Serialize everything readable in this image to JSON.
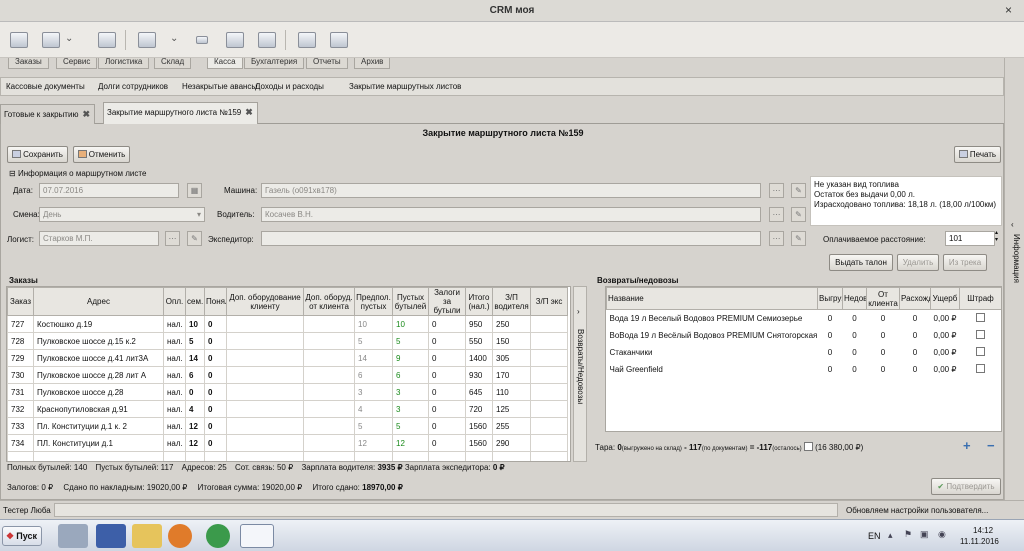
{
  "window": {
    "title": "CRM моя",
    "close": "×"
  },
  "module_tabs": [
    {
      "label": "Заказы"
    },
    {
      "label": "Сервис"
    },
    {
      "label": "Логистика"
    },
    {
      "label": "Склад"
    },
    {
      "label": "Касса"
    },
    {
      "label": "Бухгалтерия"
    },
    {
      "label": "Отчеты"
    },
    {
      "label": "Архив"
    }
  ],
  "subnav": [
    {
      "label": "Кассовые документы"
    },
    {
      "label": "Долги сотрудников"
    },
    {
      "label": "Незакрытые авансы"
    },
    {
      "label": "Доходы и расходы"
    },
    {
      "label": "Закрытие маршрутных листов"
    }
  ],
  "doc_tabs": [
    {
      "label": "Готовые к закрытию"
    },
    {
      "label": "Закрытие маршрутного листа №159"
    }
  ],
  "panel": {
    "title": "Закрытие маршрутного листа №159",
    "save_label": "Сохранить",
    "cancel_label": "Отменить",
    "print_label": "Печать",
    "info_section_label": "Информация о маршрутном листе",
    "date_label": "Дата:",
    "date_value": "07.07.2016",
    "shift_label": "Смена:",
    "shift_value": "День",
    "logist_label": "Логист:",
    "logist_value": "Старков М.П.",
    "car_label": "Машина:",
    "car_value": "Газель (о091хв178)",
    "driver_label": "Водитель:",
    "driver_value": "Косачев В.Н.",
    "forwarder_label": "Экспедитор:",
    "forwarder_value": "",
    "fuel_info": [
      "Не указан вид топлива",
      "Остаток без выдачи 0,00 л.",
      "Израсходовано топлива: 18,18 л. (18,00 л/100км)"
    ],
    "paid_distance_label": "Оплачиваемое расстояние:",
    "paid_distance_value": "101",
    "issue_coupon_label": "Выдать талон",
    "delete_label": "Удалить",
    "from_track_label": "Из трека"
  },
  "orders": {
    "title": "Заказы",
    "headers": [
      "Заказ",
      "Адрес",
      "Опл.",
      "сем.",
      "Понял",
      "Доп. оборудование клиенту",
      "Доп. оборуд. от клиента",
      "Предпол. пустых",
      "Пустых бутылей",
      "Залоги за бутыли",
      "Итого (нал.)",
      "З/П водителя",
      "З/П экс"
    ],
    "rows": [
      {
        "id": "727",
        "address": "Костюшко д.19",
        "pay": "нал.",
        "sem": "10",
        "ponyal": "0",
        "pred": "10",
        "empty": "10",
        "zalog": "0",
        "total": "950",
        "zp": "250"
      },
      {
        "id": "728",
        "address": "Пулковское шоссе д.15 к.2",
        "pay": "нал.",
        "sem": "5",
        "ponyal": "0",
        "pred": "5",
        "empty": "5",
        "zalog": "0",
        "total": "550",
        "zp": "150"
      },
      {
        "id": "729",
        "address": "Пулковское шоссе д.41 лит3А",
        "pay": "нал.",
        "sem": "14",
        "ponyal": "0",
        "pred": "14",
        "empty": "9",
        "zalog": "0",
        "total": "1400",
        "zp": "305"
      },
      {
        "id": "730",
        "address": "Пулковское шоссе д.28 лит А",
        "pay": "нал.",
        "sem": "6",
        "ponyal": "0",
        "pred": "6",
        "empty": "6",
        "zalog": "0",
        "total": "930",
        "zp": "170"
      },
      {
        "id": "731",
        "address": "Пулковское шоссе д.28",
        "pay": "нал.",
        "sem": "0",
        "ponyal": "0",
        "pred": "3",
        "empty": "3",
        "zalog": "0",
        "total": "645",
        "zp": "110"
      },
      {
        "id": "732",
        "address": "Краснопутиловская д.91",
        "pay": "нал.",
        "sem": "4",
        "ponyal": "0",
        "pred": "4",
        "empty": "3",
        "zalog": "0",
        "total": "720",
        "zp": "125"
      },
      {
        "id": "733",
        "address": "Пл. Конституции д.1 к. 2",
        "pay": "нал.",
        "sem": "12",
        "ponyal": "0",
        "pred": "5",
        "empty": "5",
        "zalog": "0",
        "total": "1560",
        "zp": "255"
      },
      {
        "id": "734",
        "address": "ПЛ. Конституции д.1",
        "pay": "нал.",
        "sem": "12",
        "ponyal": "0",
        "pred": "12",
        "empty": "12",
        "zalog": "0",
        "total": "1560",
        "zp": "290"
      }
    ]
  },
  "side_tab_label": "Возвраты/Недовозы",
  "returns": {
    "title": "Возвраты/недовозы",
    "headers": [
      "Название",
      "Выгрузка",
      "Недовоз",
      "От клиента",
      "Расхождения",
      "Ущерб",
      "Штраф"
    ],
    "rows": [
      {
        "name": "Вода 19 л Веселый Водовоз PREMIUM Семиозерье",
        "v1": "0",
        "v2": "0",
        "v3": "0",
        "v4": "0",
        "damage": "0,00 ₽"
      },
      {
        "name": "ВоВода 19 л Весёлый Водовоз PREMIUM Снятогорская",
        "v1": "0",
        "v2": "0",
        "v3": "0",
        "v4": "0",
        "damage": "0,00 ₽"
      },
      {
        "name": "Стаканчики",
        "v1": "0",
        "v2": "0",
        "v3": "0",
        "v4": "0",
        "damage": "0,00 ₽"
      },
      {
        "name": "Чай Greenfield",
        "v1": "0",
        "v2": "0",
        "v3": "0",
        "v4": "0",
        "damage": "0,00 ₽"
      }
    ],
    "tara_label": "Тара:",
    "tara_unloaded": "0",
    "tara_unloaded_note": "(выгружено на склад)",
    "tara_doc": "- 117",
    "tara_doc_note": "(по документам)",
    "tara_left": "= -117",
    "tara_left_note": "(осталось)",
    "tara_sum": "(16 380,00 ₽)",
    "plus": "+",
    "minus": "−"
  },
  "summary": {
    "full_bottles": "Полных бутылей: 140",
    "empty_bottles": "Пустых бутылей: 117",
    "addresses": "Адресов: 25",
    "sot_label": "Сот. связь: 50 ₽",
    "driver_salary_label": "Зарплата водителя:",
    "driver_salary_value": "3935 ₽",
    "forwarder_salary_label": "Зарплата экспедитора:",
    "forwarder_salary_value": "0 ₽",
    "deposits": "Залогов: 0 ₽",
    "handed_waybills": "Сдано по накладным: 19020,00 ₽",
    "total_sum": "Итоговая сумма: 19020,00 ₽",
    "total_handed_label": "Итого сдано:",
    "total_handed_value": "18970,00 ₽",
    "confirm_label": "Подтвердить"
  },
  "info_side_label": "Информация",
  "status": {
    "user": "Тестер Люба",
    "message": "Обновляем настройки пользователя..."
  },
  "taskbar": {
    "start_label": "Пуск",
    "lang": "EN",
    "time": "14:12",
    "date": "11.11.2016"
  }
}
